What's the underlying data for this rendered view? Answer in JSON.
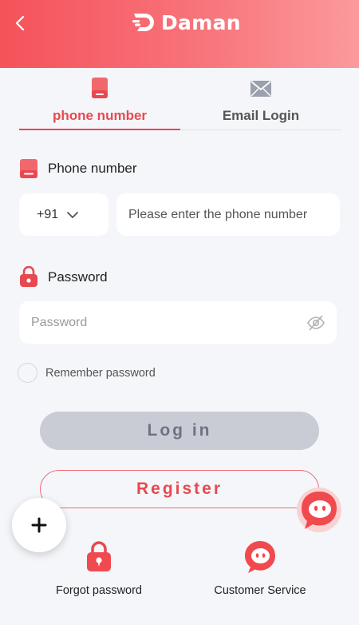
{
  "header": {
    "back_icon": "chevron-left-icon",
    "brand_name": "Daman",
    "colors": {
      "gradient_start": "#f5525a",
      "gradient_end": "#fb9a9c"
    }
  },
  "tabs": [
    {
      "label": "phone number",
      "icon": "phone-icon",
      "active": true
    },
    {
      "label": "Email Login",
      "icon": "envelope-icon",
      "active": false
    }
  ],
  "phone_section": {
    "label": "Phone number",
    "country_code": "+91",
    "placeholder": "Please enter the phone number"
  },
  "password_section": {
    "label": "Password",
    "placeholder": "Password"
  },
  "remember": {
    "label": "Remember password",
    "checked": false
  },
  "buttons": {
    "login": "Log in",
    "register": "Register"
  },
  "bottom": {
    "forgot": "Forgot password",
    "service": "Customer Service"
  },
  "colors": {
    "accent": "#e8494f",
    "background": "#f5f6fa",
    "disabled_button": "#c9cbd5"
  }
}
